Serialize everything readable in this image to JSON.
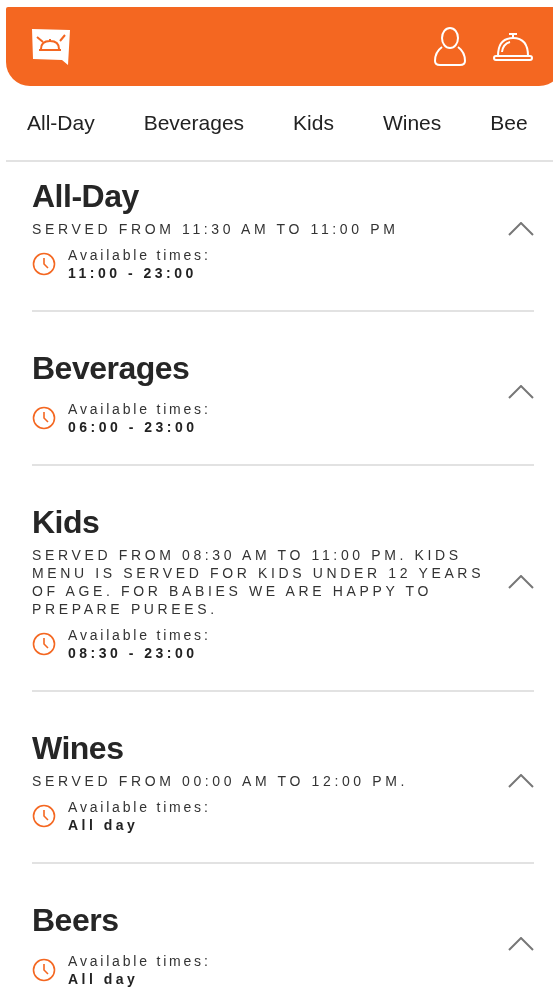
{
  "tabs": [
    {
      "label": "All-Day",
      "selected": false
    },
    {
      "label": "Beverages",
      "selected": false
    },
    {
      "label": "Kids",
      "selected": false
    },
    {
      "label": "Wines",
      "selected": false
    },
    {
      "label": "Bee",
      "selected": false
    }
  ],
  "sections": [
    {
      "title": "All-Day",
      "description": "SERVED FROM 11:30 AM TO 11:00 PM",
      "times_label": "Available times:",
      "times": "11:00 - 23:00",
      "expanded": true
    },
    {
      "title": "Beverages",
      "times_label": "Available times:",
      "times": "06:00 - 23:00",
      "expanded": true
    },
    {
      "title": "Kids",
      "description": "SERVED FROM 08:30 AM TO 11:00 PM. KIDS MENU IS SERVED FOR KIDS UNDER 12 YEARS OF AGE. FOR BABIES WE ARE HAPPY TO PREPARE PUREES.",
      "times_label": "Available times:",
      "times": "08:30 - 23:00",
      "expanded": true
    },
    {
      "title": "Wines",
      "description": "SERVED FROM 00:00 AM TO 12:00 PM.",
      "times_label": "Available times:",
      "times": "All day",
      "expanded": true
    },
    {
      "title": "Beers",
      "times_label": "Available times:",
      "times": "All day",
      "expanded": true
    }
  ]
}
